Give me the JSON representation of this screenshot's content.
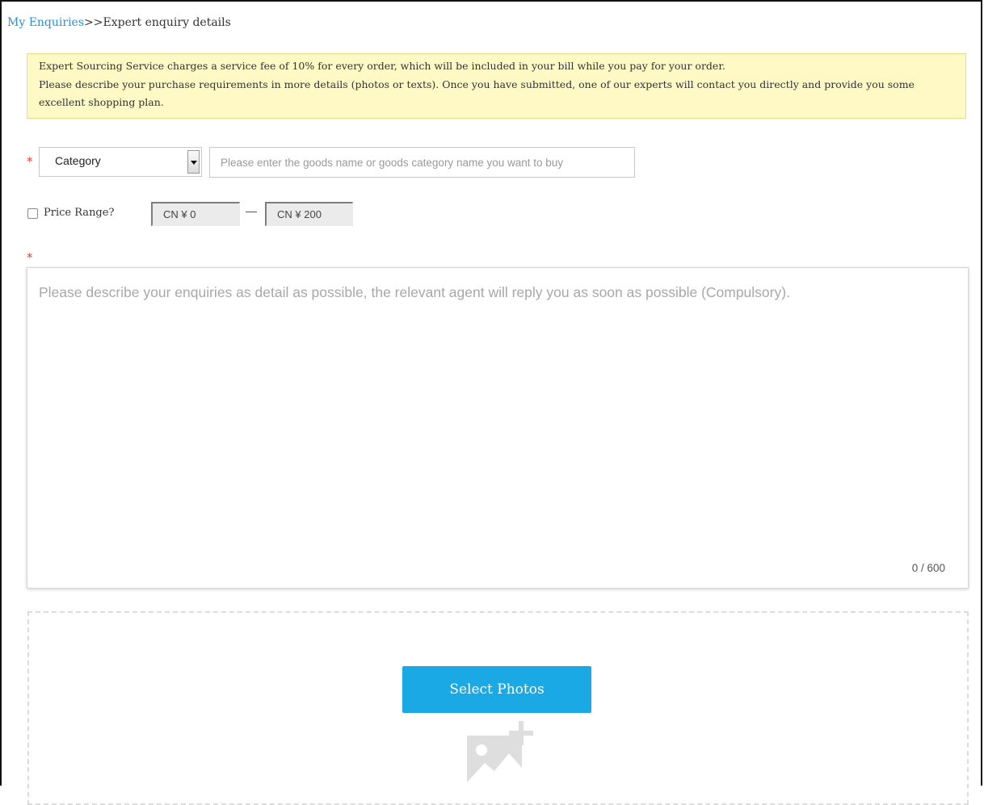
{
  "breadcrumb": {
    "link_label": "My Enquiries",
    "separator": ">>",
    "current": "Expert enquiry details"
  },
  "notice": {
    "line1": "Expert Sourcing Service charges a service fee of 10% for every order, which will be included in your bill while you pay for your order.",
    "line2": "Please describe your purchase requirements in more details (photos or texts). Once you have submitted, one of our experts will contact you directly and provide you some excellent shopping plan."
  },
  "form": {
    "required_mark": "*",
    "category_select": {
      "selected": "Category"
    },
    "goods_input": {
      "value": "",
      "placeholder": "Please enter the goods name or goods category name you want to buy"
    },
    "price_range": {
      "label": "Price Range?",
      "checked": false,
      "min_value": "CN ¥ 0",
      "max_value": "CN ¥ 200"
    },
    "description": {
      "value": "",
      "placeholder": "Please describe your enquiries as detail as possible, the relevant agent will reply you as soon as possible (Compulsory).",
      "counter": "0 / 600"
    },
    "upload": {
      "button_label": "Select Photos"
    }
  },
  "colors": {
    "link": "#2c8fe0",
    "notice_bg": "#fff9c6",
    "required": "#e8453c",
    "primary_button": "#1aa9e4"
  },
  "icons": {
    "select_arrow": "chevron-down-icon",
    "upload_placeholder": "add-photo-icon"
  }
}
